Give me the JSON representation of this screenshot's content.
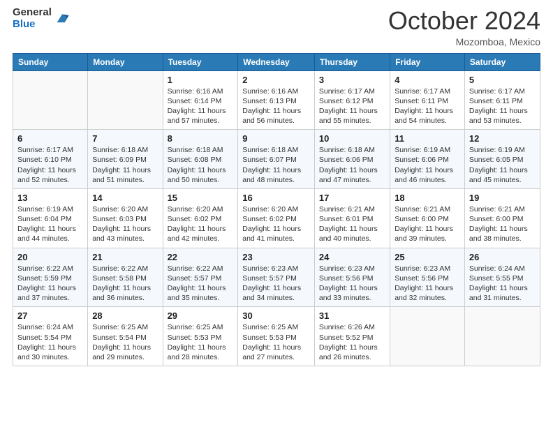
{
  "header": {
    "logo_general": "General",
    "logo_blue": "Blue",
    "month": "October 2024",
    "location": "Mozomboa, Mexico"
  },
  "days_of_week": [
    "Sunday",
    "Monday",
    "Tuesday",
    "Wednesday",
    "Thursday",
    "Friday",
    "Saturday"
  ],
  "weeks": [
    [
      {
        "day": "",
        "info": ""
      },
      {
        "day": "",
        "info": ""
      },
      {
        "day": "1",
        "info": "Sunrise: 6:16 AM\nSunset: 6:14 PM\nDaylight: 11 hours and 57 minutes."
      },
      {
        "day": "2",
        "info": "Sunrise: 6:16 AM\nSunset: 6:13 PM\nDaylight: 11 hours and 56 minutes."
      },
      {
        "day": "3",
        "info": "Sunrise: 6:17 AM\nSunset: 6:12 PM\nDaylight: 11 hours and 55 minutes."
      },
      {
        "day": "4",
        "info": "Sunrise: 6:17 AM\nSunset: 6:11 PM\nDaylight: 11 hours and 54 minutes."
      },
      {
        "day": "5",
        "info": "Sunrise: 6:17 AM\nSunset: 6:11 PM\nDaylight: 11 hours and 53 minutes."
      }
    ],
    [
      {
        "day": "6",
        "info": "Sunrise: 6:17 AM\nSunset: 6:10 PM\nDaylight: 11 hours and 52 minutes."
      },
      {
        "day": "7",
        "info": "Sunrise: 6:18 AM\nSunset: 6:09 PM\nDaylight: 11 hours and 51 minutes."
      },
      {
        "day": "8",
        "info": "Sunrise: 6:18 AM\nSunset: 6:08 PM\nDaylight: 11 hours and 50 minutes."
      },
      {
        "day": "9",
        "info": "Sunrise: 6:18 AM\nSunset: 6:07 PM\nDaylight: 11 hours and 48 minutes."
      },
      {
        "day": "10",
        "info": "Sunrise: 6:18 AM\nSunset: 6:06 PM\nDaylight: 11 hours and 47 minutes."
      },
      {
        "day": "11",
        "info": "Sunrise: 6:19 AM\nSunset: 6:06 PM\nDaylight: 11 hours and 46 minutes."
      },
      {
        "day": "12",
        "info": "Sunrise: 6:19 AM\nSunset: 6:05 PM\nDaylight: 11 hours and 45 minutes."
      }
    ],
    [
      {
        "day": "13",
        "info": "Sunrise: 6:19 AM\nSunset: 6:04 PM\nDaylight: 11 hours and 44 minutes."
      },
      {
        "day": "14",
        "info": "Sunrise: 6:20 AM\nSunset: 6:03 PM\nDaylight: 11 hours and 43 minutes."
      },
      {
        "day": "15",
        "info": "Sunrise: 6:20 AM\nSunset: 6:02 PM\nDaylight: 11 hours and 42 minutes."
      },
      {
        "day": "16",
        "info": "Sunrise: 6:20 AM\nSunset: 6:02 PM\nDaylight: 11 hours and 41 minutes."
      },
      {
        "day": "17",
        "info": "Sunrise: 6:21 AM\nSunset: 6:01 PM\nDaylight: 11 hours and 40 minutes."
      },
      {
        "day": "18",
        "info": "Sunrise: 6:21 AM\nSunset: 6:00 PM\nDaylight: 11 hours and 39 minutes."
      },
      {
        "day": "19",
        "info": "Sunrise: 6:21 AM\nSunset: 6:00 PM\nDaylight: 11 hours and 38 minutes."
      }
    ],
    [
      {
        "day": "20",
        "info": "Sunrise: 6:22 AM\nSunset: 5:59 PM\nDaylight: 11 hours and 37 minutes."
      },
      {
        "day": "21",
        "info": "Sunrise: 6:22 AM\nSunset: 5:58 PM\nDaylight: 11 hours and 36 minutes."
      },
      {
        "day": "22",
        "info": "Sunrise: 6:22 AM\nSunset: 5:57 PM\nDaylight: 11 hours and 35 minutes."
      },
      {
        "day": "23",
        "info": "Sunrise: 6:23 AM\nSunset: 5:57 PM\nDaylight: 11 hours and 34 minutes."
      },
      {
        "day": "24",
        "info": "Sunrise: 6:23 AM\nSunset: 5:56 PM\nDaylight: 11 hours and 33 minutes."
      },
      {
        "day": "25",
        "info": "Sunrise: 6:23 AM\nSunset: 5:56 PM\nDaylight: 11 hours and 32 minutes."
      },
      {
        "day": "26",
        "info": "Sunrise: 6:24 AM\nSunset: 5:55 PM\nDaylight: 11 hours and 31 minutes."
      }
    ],
    [
      {
        "day": "27",
        "info": "Sunrise: 6:24 AM\nSunset: 5:54 PM\nDaylight: 11 hours and 30 minutes."
      },
      {
        "day": "28",
        "info": "Sunrise: 6:25 AM\nSunset: 5:54 PM\nDaylight: 11 hours and 29 minutes."
      },
      {
        "day": "29",
        "info": "Sunrise: 6:25 AM\nSunset: 5:53 PM\nDaylight: 11 hours and 28 minutes."
      },
      {
        "day": "30",
        "info": "Sunrise: 6:25 AM\nSunset: 5:53 PM\nDaylight: 11 hours and 27 minutes."
      },
      {
        "day": "31",
        "info": "Sunrise: 6:26 AM\nSunset: 5:52 PM\nDaylight: 11 hours and 26 minutes."
      },
      {
        "day": "",
        "info": ""
      },
      {
        "day": "",
        "info": ""
      }
    ]
  ]
}
